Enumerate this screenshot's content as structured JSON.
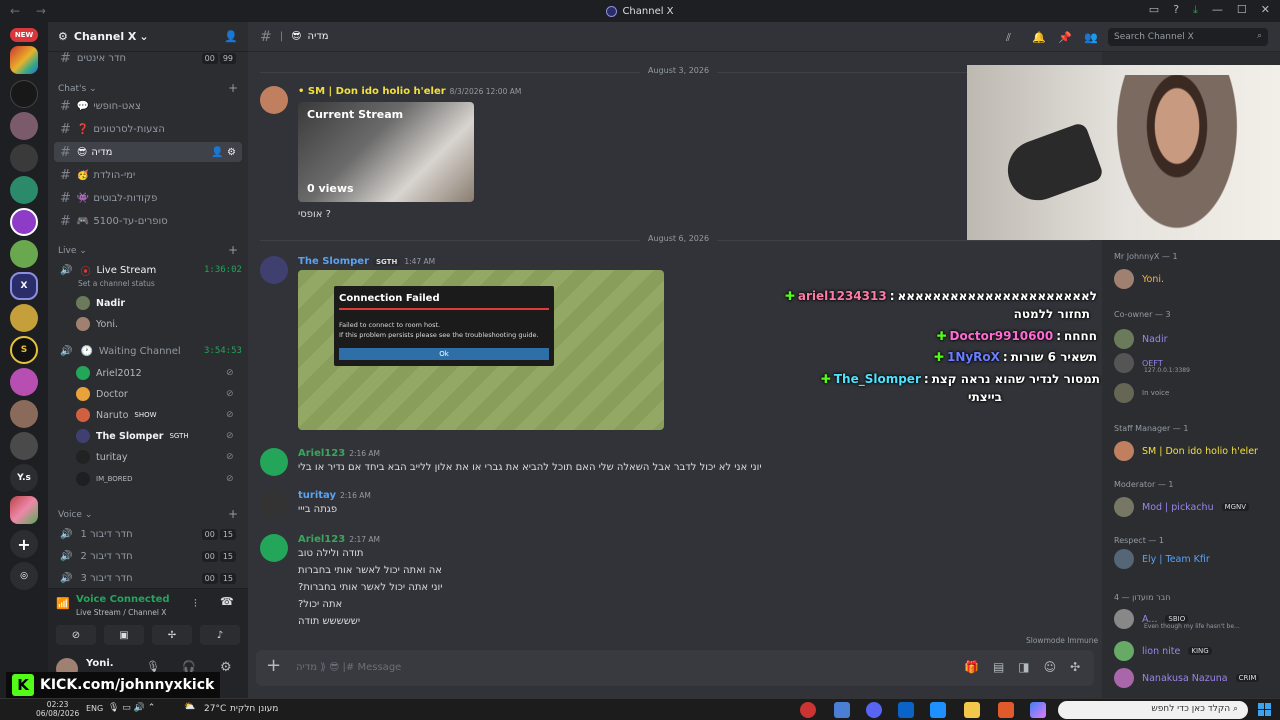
{
  "window": {
    "title": "Channel X"
  },
  "server": {
    "name": "Channel X",
    "new_badge": "NEW",
    "rail_labels": [
      "Y.s"
    ]
  },
  "channels": {
    "top": {
      "name": "חדר אינטים",
      "count": "00",
      "cap": "99"
    },
    "chats_label": "Chat's",
    "chats": [
      {
        "name": "צאט-חופשי"
      },
      {
        "name": "הצעות-לסרטונים"
      },
      {
        "name": "מדיה"
      },
      {
        "name": "ימי-הולדת"
      },
      {
        "name": "פקודות-לבוטים"
      },
      {
        "name": "סופרים-עד-5100"
      }
    ],
    "live_label": "Live",
    "live": {
      "name": "Live Stream",
      "timer": "1:36:02",
      "status": "Set a channel status",
      "users": [
        "Nadir",
        "Yoni."
      ]
    },
    "waiting": {
      "name": "Waiting Channel",
      "timer": "3:54:53",
      "users": [
        "Ariel2012",
        "Doctor",
        "Naruto",
        "The Slomper",
        "turitay",
        "IM_BORED"
      ],
      "naruto_tag": "SHOW",
      "slomper_tag": "SGTH"
    },
    "voice_label": "Voice",
    "voice": [
      {
        "name": "חדר דיבור 1",
        "count": "00",
        "cap": "15"
      },
      {
        "name": "חדר דיבור 2",
        "count": "00",
        "cap": "15"
      },
      {
        "name": "חדר דיבור 3",
        "count": "00",
        "cap": "15"
      }
    ]
  },
  "voicebar": {
    "status": "Voice Connected",
    "sub": "Live Stream / Channel X",
    "user": "Yoni."
  },
  "topbar": {
    "channel": "מדיה",
    "search_placeholder": "Search Channel X"
  },
  "messages": {
    "date1": "August 3, 2026",
    "m1": {
      "author": "SM | Don ido holio h'eler",
      "time": "8/3/2026 12:00 AM",
      "text": "אופסי ?",
      "embed_title": "Current Stream",
      "embed_views": "0 views"
    },
    "date2": "August 6, 2026",
    "m2": {
      "author": "The Slomper",
      "tag": "SGTH",
      "time": "1:47 AM",
      "dialog_title": "Connection Failed",
      "dialog_l1": "Failed to connect to room host.",
      "dialog_l2": "If this problem persists please see the troubleshooting guide.",
      "dialog_ok": "Ok"
    },
    "m3": {
      "author": "Ariel123",
      "time": "2:16 AM",
      "text": "יוני אני לא יכול לדבר אבל השאלה שלי האם תוכל להביא את גברי או את אלון ללייב הבא ביחד אם נדיר או בלי"
    },
    "m4": {
      "author": "turitay",
      "time": "2:16 AM",
      "text": "פגתה בייי"
    },
    "m5": {
      "author": "Ariel123",
      "time": "2:17 AM",
      "lines": [
        "תודה ולילה טוב",
        "אה ואתה יכול לאשר אותי בחברות",
        "יוני אתה יכול לאשר אותי בחברות?",
        "אתה יכול?",
        "יששששש תודה"
      ]
    },
    "slowmode": "Slowmode Immune"
  },
  "input": {
    "placeholder": "Message #| 😎 ⟪ מדיה"
  },
  "overlay_chat": [
    {
      "user": "ariel1234313",
      "text": "לאאאאאאאאאאאאאאאאאאאאאא",
      "color": "#ff7aa8"
    },
    {
      "user": "",
      "text": "תחזור ללמטה",
      "color": "#ffffff"
    },
    {
      "user": "Doctor9910600",
      "text": "חחחח",
      "color": "#ff6ad5"
    },
    {
      "user": "1NyRoX",
      "text": "תשאיר 6 שורות",
      "color": "#6a7dff"
    },
    {
      "user": "The_Slomper",
      "text": "תמסור לנדיר שהוא נראה קצת",
      "color": "#4ee4ff"
    },
    {
      "user": "",
      "text": "בייצתי",
      "color": "#ffffff"
    }
  ],
  "members": {
    "groups": [
      {
        "label": "Mr JohnnyX — 1",
        "users": [
          {
            "name": "Yoni.",
            "color": "#f9b23c"
          }
        ]
      },
      {
        "label": "Co-owner — 3",
        "users": [
          {
            "name": "Nadir",
            "color": "#9b84ee"
          },
          {
            "name": "OEFT",
            "color": "#9b84ee"
          }
        ]
      },
      {
        "label": "Staff Manager — 1",
        "users": [
          {
            "name": "SM | Don ido holio h'eler",
            "color": "#f3e03b"
          }
        ]
      },
      {
        "label": "Moderator — 1",
        "users": [
          {
            "name": "Mod | pickachu",
            "color": "#9b84ee"
          }
        ]
      },
      {
        "label": "Respect — 1",
        "users": [
          {
            "name": "Ely | Team Kfir",
            "color": "#5aa2f2"
          }
        ]
      },
      {
        "label": "חבר מועדון — 4",
        "users": [
          {
            "name": "A...",
            "color": "#9b84ee"
          },
          {
            "name": "lion nite",
            "color": "#9b84ee"
          },
          {
            "name": "Nanakusa Nazuna",
            "color": "#9b84ee"
          }
        ]
      }
    ],
    "sub_texts": [
      "In voice",
      "Even though my life hasn't be...",
      "127.0.0.1:3389"
    ],
    "tags": {
      "pickachu": "MGNV",
      "a": "SBIO",
      "lion": "KING",
      "nanakusa": "CRIM"
    }
  },
  "kick": {
    "text": "KICK.com/johnnyxkick"
  },
  "taskbar": {
    "time": "02:23",
    "date": "06/08/2026",
    "lang": "ENG",
    "weather": "27°C",
    "weather_text": "מעונן חלקית",
    "search": "הקלד כאן כדי לחפש"
  }
}
